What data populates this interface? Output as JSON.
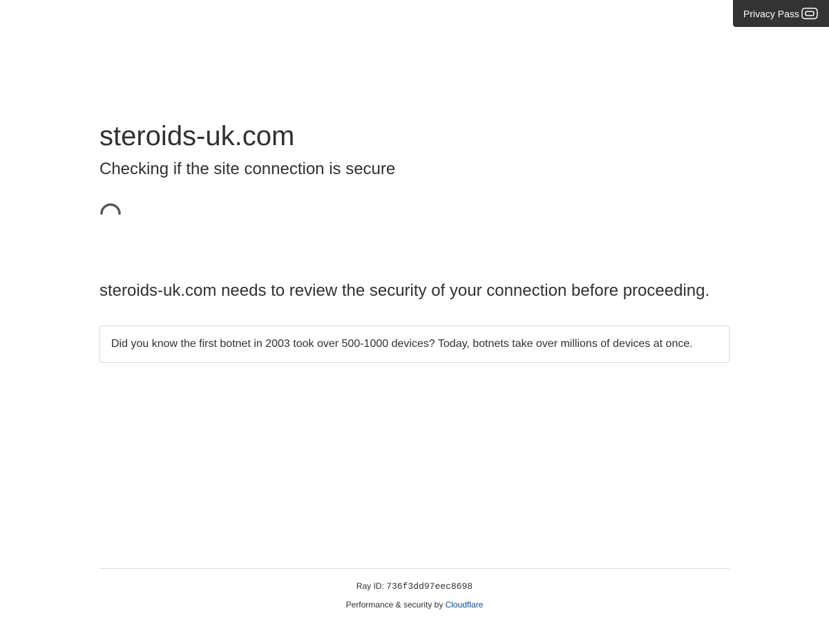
{
  "privacy_pass": {
    "label": "Privacy Pass",
    "icon": "privacy-pass-icon"
  },
  "main": {
    "title": "steroids-uk.com",
    "subtitle": "Checking if the site connection is secure",
    "spinner_icon": "loading-spinner-icon",
    "review_text": "steroids-uk.com needs to review the security of your connection before proceeding.",
    "fact_text": "Did you know the first botnet in 2003 took over 500-1000 devices? Today, botnets take over millions of devices at once."
  },
  "footer": {
    "ray_label": "Ray ID:",
    "ray_id": "736f3dd97eec8698",
    "performance_label": "Performance & security by",
    "provider_link": "Cloudflare",
    "link_color": "#0051c3"
  }
}
